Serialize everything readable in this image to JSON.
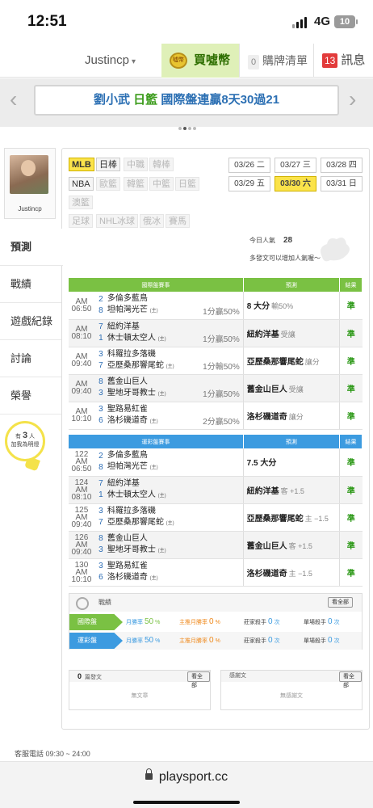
{
  "status": {
    "time": "12:51",
    "network": "4G",
    "battery": "10"
  },
  "nav": {
    "username": "Justincp",
    "caret": "▾",
    "buy_label": "買噓幣",
    "coin_label": "噓幣",
    "cart_count": "0",
    "cart_label": "購牌清單",
    "msg_count": "13",
    "msg_label": "訊息"
  },
  "banner": {
    "name": "劉小武",
    "league": "日籃",
    "text": "國際盤連贏8天30過21",
    "prev": "‹",
    "next": "›"
  },
  "sidebar": {
    "username": "Justincp",
    "items": [
      "預測",
      "戰績",
      "遊戲紀錄",
      "討論",
      "榮譽"
    ],
    "bulb_pre": "有",
    "bulb_count": "3",
    "bulb_post": "人",
    "bulb_line2": "加我為明燈"
  },
  "sports": [
    {
      "label": "MLB",
      "state": "on"
    },
    {
      "label": "日棒",
      "state": ""
    },
    {
      "label": "中職",
      "state": "dis"
    },
    {
      "label": "韓棒",
      "state": "dis"
    },
    {
      "label": "NBA",
      "state": ""
    },
    {
      "label": "歐籃",
      "state": "dis"
    },
    {
      "label": "韓籃",
      "state": "dis"
    },
    {
      "label": "中籃",
      "state": "dis"
    },
    {
      "label": "日籃",
      "state": "dis"
    },
    {
      "label": "澳籃",
      "state": "dis"
    },
    {
      "label": "足球",
      "state": "dis"
    },
    {
      "label": "NHL冰球",
      "state": "dis"
    },
    {
      "label": "俄冰",
      "state": "dis"
    },
    {
      "label": "賽馬",
      "state": "dis"
    }
  ],
  "dates": [
    {
      "label": "03/26 二",
      "state": ""
    },
    {
      "label": "03/27 三",
      "state": ""
    },
    {
      "label": "03/28 四",
      "state": ""
    },
    {
      "label": "03/29 五",
      "state": ""
    },
    {
      "label": "03/30 六",
      "state": "on"
    },
    {
      "label": "03/31 日",
      "state": ""
    }
  ],
  "popularity": {
    "label": "今日人氣",
    "value": "28",
    "hint": "多發文可以增加人氣喔～"
  },
  "intl": {
    "headers": [
      "國際盤賽事",
      "預測",
      "結果"
    ],
    "rows": [
      {
        "time": "AM 06:50",
        "n1": "2",
        "n2": "8",
        "t1": "多倫多藍鳥",
        "t2": "坦帕灣光芒",
        "home": "(主)",
        "res": "1分贏50%",
        "pick": "8 大分",
        "note": "輸50%",
        "jz": "準"
      },
      {
        "time": "AM 08:10",
        "n1": "7",
        "n2": "1",
        "t1": "紐約洋基",
        "t2": "休士頓太空人",
        "home": "(主)",
        "res": "1分贏50%",
        "pick": "紐約洋基",
        "note": "受讓",
        "jz": "準"
      },
      {
        "time": "AM 09:40",
        "n1": "3",
        "n2": "7",
        "t1": "科羅拉多落磯",
        "t2": "亞歷桑那響尾蛇",
        "home": "(主)",
        "res": "1分輸50%",
        "pick": "亞歷桑那響尾蛇",
        "note": "讓分",
        "jz": "準"
      },
      {
        "time": "AM 09:40",
        "n1": "8",
        "n2": "3",
        "t1": "舊金山巨人",
        "t2": "聖地牙哥教士",
        "home": "(主)",
        "res": "1分贏50%",
        "pick": "舊金山巨人",
        "note": "受讓",
        "jz": "準"
      },
      {
        "time": "AM 10:10",
        "n1": "3",
        "n2": "6",
        "t1": "聖路易紅雀",
        "t2": "洛杉磯道奇",
        "home": "(主)",
        "res": "2分贏50%",
        "pick": "洛杉磯道奇",
        "note": "讓分",
        "jz": "準"
      }
    ]
  },
  "lottery": {
    "headers": [
      "運彩盤賽事",
      "預測",
      "結果"
    ],
    "rows": [
      {
        "code": "122",
        "time": "AM 06:50",
        "n1": "2",
        "n2": "8",
        "t1": "多倫多藍鳥",
        "t2": "坦帕灣光芒",
        "home": "(主)",
        "pick": "7.5 大分",
        "note": "",
        "jz": "準"
      },
      {
        "code": "124",
        "time": "AM 08:10",
        "n1": "7",
        "n2": "1",
        "t1": "紐約洋基",
        "t2": "休士頓太空人",
        "home": "(主)",
        "pick": "紐約洋基",
        "note": "客 +1.5",
        "jz": "準"
      },
      {
        "code": "125",
        "time": "AM 09:40",
        "n1": "3",
        "n2": "7",
        "t1": "科羅拉多落磯",
        "t2": "亞歷桑那響尾蛇",
        "home": "(主)",
        "pick": "亞歷桑那響尾蛇",
        "note": "主 −1.5",
        "jz": "準"
      },
      {
        "code": "126",
        "time": "AM 09:40",
        "n1": "8",
        "n2": "3",
        "t1": "舊金山巨人",
        "t2": "聖地牙哥教士",
        "home": "(主)",
        "pick": "舊金山巨人",
        "note": "客 +1.5",
        "jz": "準"
      },
      {
        "code": "130",
        "time": "AM 10:10",
        "n1": "3",
        "n2": "6",
        "t1": "聖路易紅雀",
        "t2": "洛杉磯道奇",
        "home": "(主)",
        "pick": "洛杉磯道奇",
        "note": "主 −1.5",
        "jz": "準"
      }
    ]
  },
  "record": {
    "title": "戰績",
    "all": "看全部",
    "rows": [
      {
        "label": "國際盤",
        "color": "#7ac143",
        "m_lbl": "月勝率",
        "m_val": "50",
        "m_unit": "%",
        "h_lbl": "主推月勝率",
        "h_val": "0",
        "h_unit": "%",
        "z_lbl": "莊家殺手",
        "z_val": "0",
        "z_unit": "次",
        "d_lbl": "單場殺手",
        "d_val": "0",
        "d_unit": "次"
      },
      {
        "label": "運彩盤",
        "color": "#3c9be0",
        "m_lbl": "月勝率",
        "m_val": "50",
        "m_unit": "%",
        "h_lbl": "主推月勝率",
        "h_val": "0",
        "h_unit": "%",
        "z_lbl": "莊家殺手",
        "z_val": "0",
        "z_unit": "次",
        "d_lbl": "單場殺手",
        "d_val": "0",
        "d_unit": "次"
      }
    ]
  },
  "posts": {
    "count": "0",
    "label": "篇發文",
    "all": "看全部",
    "empty": "無文章"
  },
  "thanks": {
    "label": "感謝文",
    "all": "看全部",
    "empty": "無感謝文"
  },
  "footer": {
    "service": "客服電話 09:30 ~ 24:00",
    "url": "playsport.cc"
  },
  "colors": {
    "intl_header": "#7ac143",
    "lottery_header": "#3c9be0",
    "accent_yellow": "#fbe34a",
    "result_green": "#2f9a1a"
  }
}
